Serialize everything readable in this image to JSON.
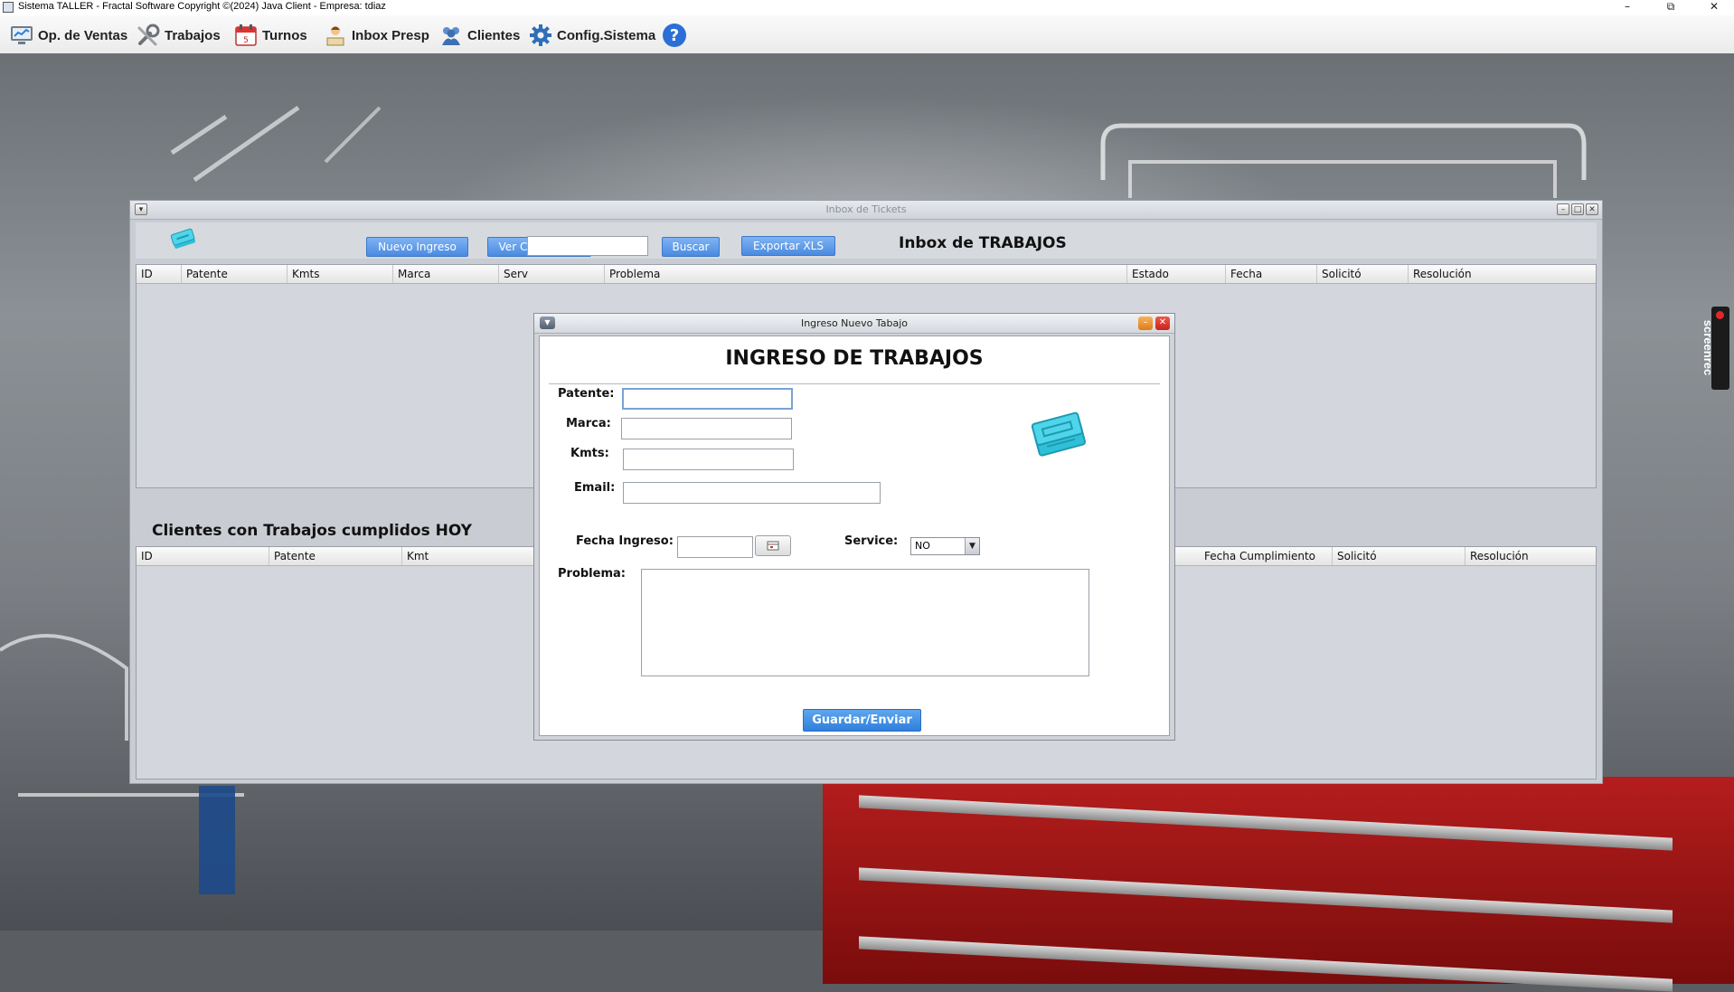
{
  "window": {
    "title": "Sistema TALLER - Fractal Software Copyright ©(2024) Java Client - Empresa: tdiaz",
    "controls": [
      "minimize-icon",
      "maximize-icon",
      "close-icon"
    ]
  },
  "menu": {
    "items": [
      {
        "label": "Op. de Ventas",
        "icon": "monitor-chart-icon"
      },
      {
        "label": "Trabajos",
        "icon": "wrench-icon"
      },
      {
        "label": "Turnos",
        "icon": "calendar-icon"
      },
      {
        "label": "Inbox Presp",
        "icon": "person-icon"
      },
      {
        "label": "Clientes",
        "icon": "users-icon"
      },
      {
        "label": "Config.Sistema",
        "icon": "gear-icon"
      },
      {
        "label": "",
        "icon": "help-icon"
      }
    ]
  },
  "inbox": {
    "title": "Inbox de Tickets",
    "toolbar": {
      "nuevo_ingreso": "Nuevo Ingreso",
      "ver_cumplidos": "Ver Clumplidos",
      "search_value": "",
      "buscar": "Buscar",
      "exportar": "Exportar XLS"
    },
    "heading": "Inbox de TRABAJOS",
    "table1": {
      "columns": [
        "ID",
        "Patente",
        "Kmts",
        "Marca",
        "Serv",
        "Problema",
        "Estado",
        "Fecha",
        "Solicitó",
        "Resolución"
      ]
    },
    "clients_heading": "Clientes con Trabajos cumplidos HOY",
    "table2": {
      "columns": [
        "ID",
        "Patente",
        "Kmt",
        "Fecha Cumplimiento",
        "Solicitó",
        "Resolución"
      ]
    }
  },
  "dialog": {
    "title": "Ingreso Nuevo Tabajo",
    "heading": "INGRESO DE TRABAJOS",
    "labels": {
      "patente": "Patente:",
      "marca": "Marca:",
      "kmts": "Kmts:",
      "email": "Email:",
      "fecha_ingreso": "Fecha Ingreso:",
      "service": "Service:",
      "problema": "Problema:"
    },
    "values": {
      "patente": "",
      "marca": "",
      "kmts": "",
      "email": "",
      "fecha_ingreso": "",
      "service": "NO",
      "problema": ""
    },
    "save_button": "Guardar/Enviar"
  },
  "overlay": {
    "screenrec_label": "screenrec"
  },
  "colors": {
    "accent_blue": "#4a8ae0",
    "frame_gray": "#c9ccd2",
    "ticket_cyan": "#2fc0d8"
  }
}
